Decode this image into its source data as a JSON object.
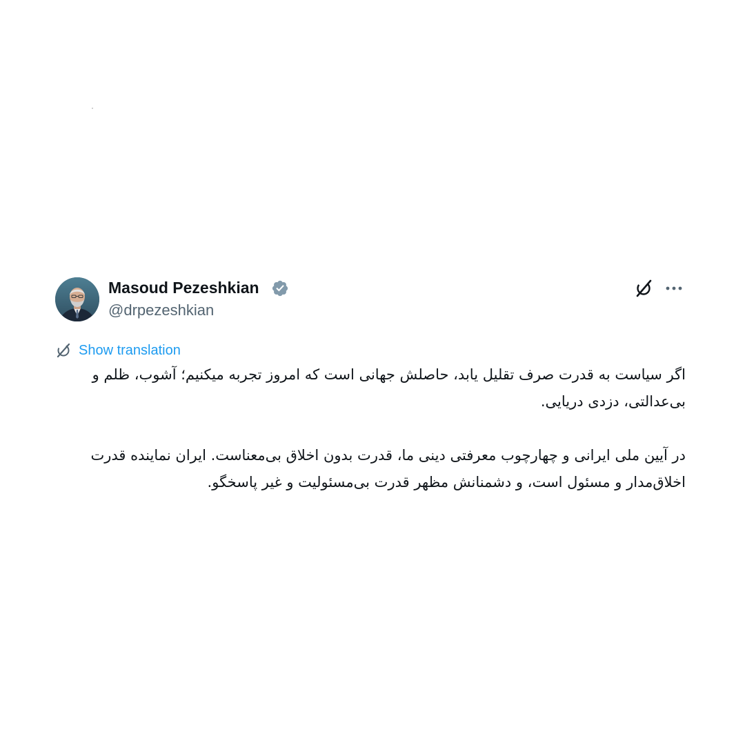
{
  "author": {
    "display_name": "Masoud Pezeshkian",
    "handle": "@drpezeshkian",
    "verified": true,
    "avatar_icon": "profile-photo"
  },
  "icons": {
    "verified": "verified-badge-icon",
    "grok": "grok-icon",
    "more": "more-options-icon",
    "translate": "translate-icon"
  },
  "translation": {
    "label": "Show translation"
  },
  "tweet": {
    "paragraphs": [
      "اگر سیاست به قدرت صرف تقلیل یابد، حاصلش جهانی است که امروز تجربه میکنیم؛ آشوب، ظلم و بی‌عدالتی، دزدی دریایی.",
      "در آیین ملی ایرانی و چهارچوب معرفتی دینی ما، قدرت بدون اخلاق بی‌معناست. ایران نماینده قدرت اخلاق‌مدار و مسئول است، و دشمنانش مظهر قدرت بی‌مسئولیت و غیر پاسخگو."
    ]
  },
  "colors": {
    "text_primary": "#0f1419",
    "text_secondary": "#536471",
    "link": "#1d9bf0",
    "verified_badge": "#829aab",
    "background": "#ffffff"
  }
}
